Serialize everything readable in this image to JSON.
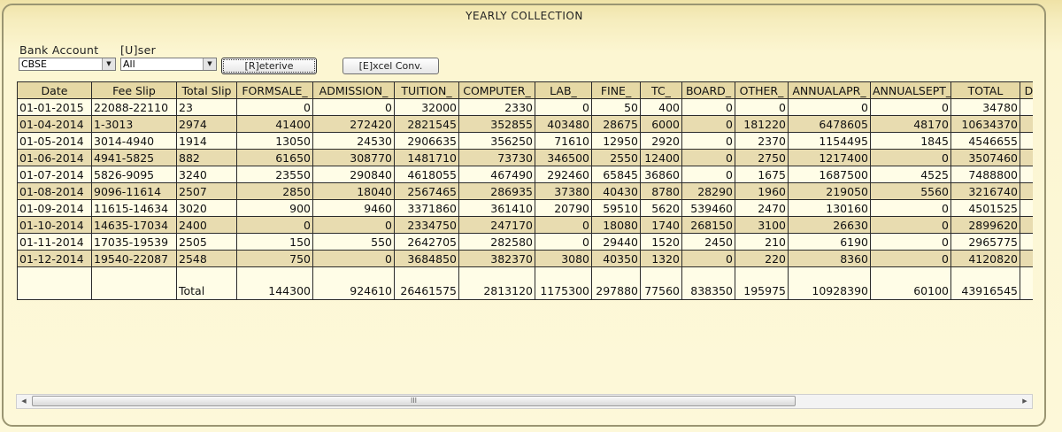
{
  "window": {
    "title": "YEARLY COLLECTION"
  },
  "filters": {
    "bank_account_label": "Bank Account",
    "bank_account_value": "CBSE",
    "user_label": "[U]ser",
    "user_value": "All",
    "retrieve_label": "[R]eterive",
    "excel_label": "[E]xcel Conv."
  },
  "grid": {
    "columns": [
      "Date",
      "Fee Slip",
      "Total Slip",
      "FORMSALE_",
      "ADMISSION_",
      "TUITION_",
      "COMPUTER_",
      "LAB_",
      "FINE_",
      "TC_",
      "BOARD_",
      "OTHER_",
      "ANNUALAPR_",
      "ANNUALSEPT_",
      "TOTAL",
      "D"
    ],
    "rows": [
      [
        "01-01-2015",
        "22088-22110",
        "23",
        "0",
        "0",
        "32000",
        "2330",
        "0",
        "50",
        "400",
        "0",
        "0",
        "0",
        "0",
        "34780",
        ""
      ],
      [
        "01-04-2014",
        "1-3013",
        "2974",
        "41400",
        "272420",
        "2821545",
        "352855",
        "403480",
        "28675",
        "6000",
        "0",
        "181220",
        "6478605",
        "48170",
        "10634370",
        ""
      ],
      [
        "01-05-2014",
        "3014-4940",
        "1914",
        "13050",
        "24530",
        "2906635",
        "356250",
        "71610",
        "12950",
        "2920",
        "0",
        "2370",
        "1154495",
        "1845",
        "4546655",
        ""
      ],
      [
        "01-06-2014",
        "4941-5825",
        "882",
        "61650",
        "308770",
        "1481710",
        "73730",
        "346500",
        "2550",
        "12400",
        "0",
        "2750",
        "1217400",
        "0",
        "3507460",
        ""
      ],
      [
        "01-07-2014",
        "5826-9095",
        "3240",
        "23550",
        "290840",
        "4618055",
        "467490",
        "292460",
        "65845",
        "36860",
        "0",
        "1675",
        "1687500",
        "4525",
        "7488800",
        ""
      ],
      [
        "01-08-2014",
        "9096-11614",
        "2507",
        "2850",
        "18040",
        "2567465",
        "286935",
        "37380",
        "40430",
        "8780",
        "28290",
        "1960",
        "219050",
        "5560",
        "3216740",
        ""
      ],
      [
        "01-09-2014",
        "11615-14634",
        "3020",
        "900",
        "9460",
        "3371860",
        "361410",
        "20790",
        "59510",
        "5620",
        "539460",
        "2470",
        "130160",
        "0",
        "4501525",
        ""
      ],
      [
        "01-10-2014",
        "14635-17034",
        "2400",
        "0",
        "0",
        "2334750",
        "247170",
        "0",
        "18080",
        "1740",
        "268150",
        "3100",
        "26630",
        "0",
        "2899620",
        ""
      ],
      [
        "01-11-2014",
        "17035-19539",
        "2505",
        "150",
        "550",
        "2642705",
        "282580",
        "0",
        "29440",
        "1520",
        "2450",
        "210",
        "6190",
        "0",
        "2965775",
        ""
      ],
      [
        "01-12-2014",
        "19540-22087",
        "2548",
        "750",
        "0",
        "3684850",
        "382370",
        "3080",
        "40350",
        "1320",
        "0",
        "220",
        "8360",
        "0",
        "4120820",
        ""
      ]
    ],
    "total_row": [
      "",
      "",
      "Total",
      "144300",
      "924610",
      "26461575",
      "2813120",
      "1175300",
      "297880",
      "77560",
      "838350",
      "195975",
      "10928390",
      "60100",
      "43916545",
      ""
    ]
  },
  "scrollbar": {
    "left_icon": "arrow-left-icon",
    "right_icon": "arrow-right-icon",
    "grip": "III"
  }
}
